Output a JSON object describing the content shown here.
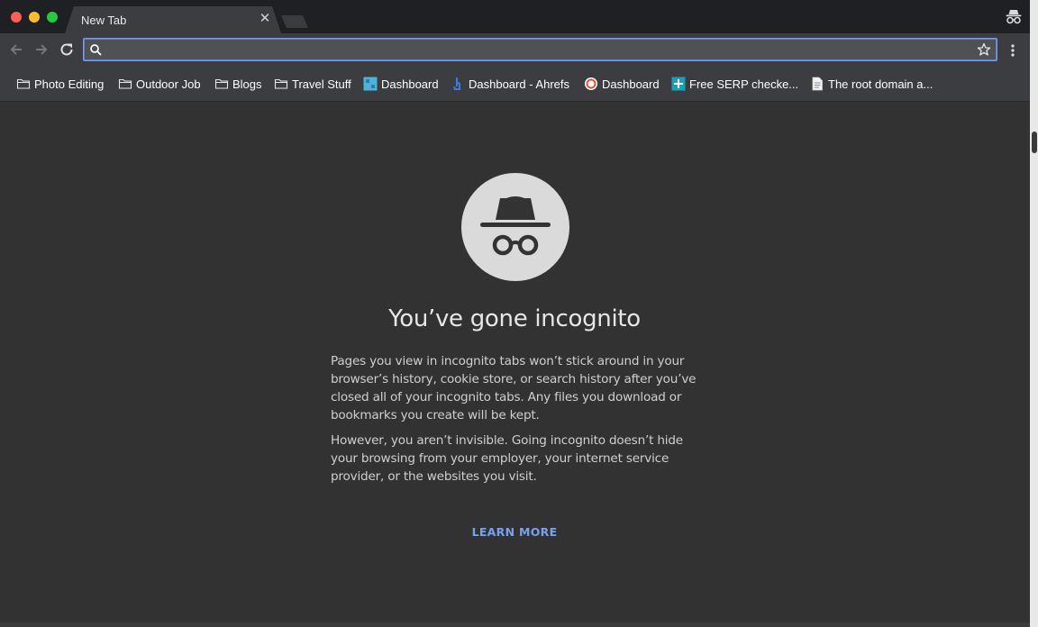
{
  "window": {
    "tab": {
      "title": "New Tab",
      "close_glyph": "✕"
    }
  },
  "toolbar": {
    "back_icon": "arrow-left-icon",
    "forward_icon": "arrow-right-icon",
    "reload_icon": "reload-icon",
    "omnibox": {
      "value": "",
      "placeholder": ""
    },
    "star_icon": "star-icon",
    "menu_icon": "more-vert-icon"
  },
  "bookmarks": {
    "items": [
      {
        "label": "Photo Editing",
        "icon": "folder-icon"
      },
      {
        "label": "Outdoor Job",
        "icon": "folder-icon"
      },
      {
        "label": "Blogs",
        "icon": "folder-icon"
      },
      {
        "label": "Travel Stuff",
        "icon": "folder-icon"
      },
      {
        "label": "Dashboard",
        "icon": "seo-favicon-icon"
      },
      {
        "label": "Dashboard - Ahrefs",
        "icon": "ahrefs-favicon-icon"
      },
      {
        "label": "Dashboard",
        "icon": "circle-favicon-icon"
      },
      {
        "label": "Free SERP checke...",
        "icon": "serp-favicon-icon"
      },
      {
        "label": "The root domain a...",
        "icon": "document-icon"
      }
    ]
  },
  "content": {
    "headline": "You’ve gone incognito",
    "paragraph1": "Pages you view in incognito tabs won’t stick around in your browser’s history, cookie store, or search history after you’ve closed all of your incognito tabs. Any files you download or bookmarks you create will be kept.",
    "paragraph2": "However, you aren’t invisible. Going incognito doesn’t hide your browsing from your employer, your internet service provider, or the websites you visit.",
    "learn_more": "LEARN MORE",
    "hero_icon": "incognito-icon"
  },
  "colors": {
    "page_bg": "#323232",
    "chrome_bg": "#3c3d41",
    "tabstrip_bg": "#1f2024",
    "link": "#7aa2e8",
    "omnibox_focus": "#7e9ce6"
  }
}
